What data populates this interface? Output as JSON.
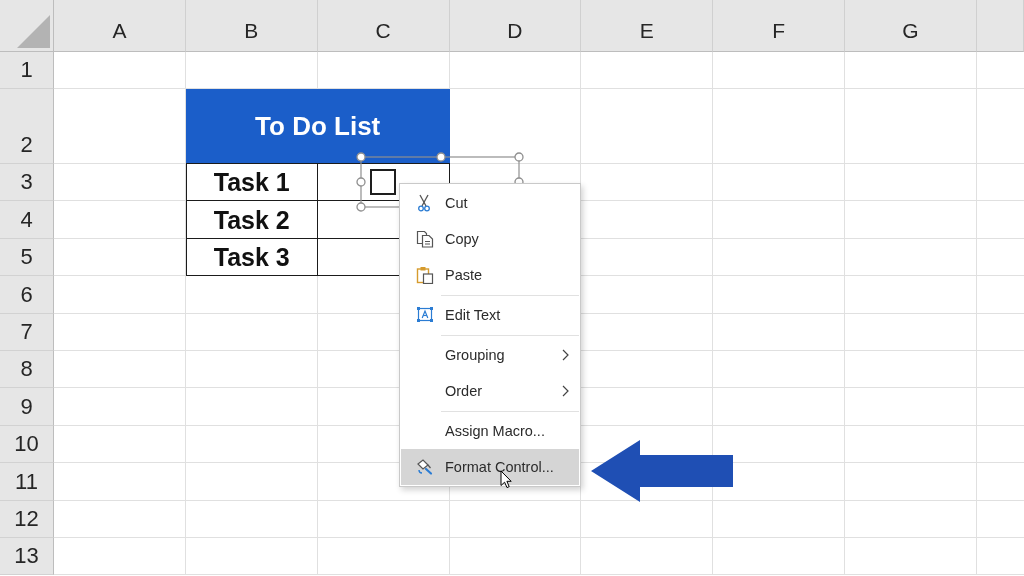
{
  "sheet": {
    "columns": [
      "A",
      "B",
      "C",
      "D",
      "E",
      "F",
      "G"
    ],
    "rows": [
      "1",
      "2",
      "3",
      "4",
      "5",
      "6",
      "7",
      "8",
      "9",
      "10",
      "11",
      "12",
      "13"
    ]
  },
  "todo_table": {
    "title": "To Do List",
    "tasks": [
      "Task 1",
      "Task 2",
      "Task 3"
    ]
  },
  "checkbox_control": {
    "checked": false,
    "selected": true
  },
  "context_menu": {
    "groups": [
      [
        {
          "label": "Cut",
          "has_submenu": false,
          "selected": false
        },
        {
          "label": "Copy",
          "has_submenu": false,
          "selected": false
        },
        {
          "label": "Paste",
          "has_submenu": false,
          "selected": false
        }
      ],
      [
        {
          "label": "Edit Text",
          "has_submenu": false,
          "selected": false
        }
      ],
      [
        {
          "label": "Grouping",
          "has_submenu": true,
          "selected": false
        },
        {
          "label": "Order",
          "has_submenu": true,
          "selected": false
        }
      ],
      [
        {
          "label": "Assign Macro...",
          "has_submenu": false,
          "selected": false
        },
        {
          "label": "Format Control...",
          "has_submenu": false,
          "selected": true
        }
      ]
    ]
  }
}
